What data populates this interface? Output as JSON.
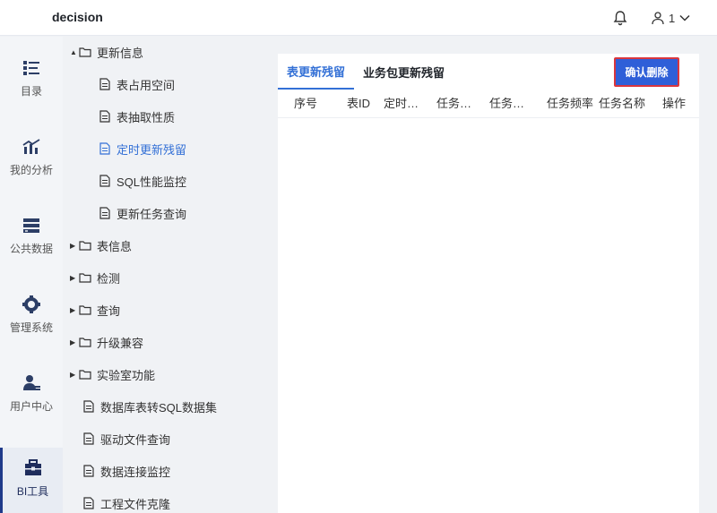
{
  "header": {
    "app_title": "decision",
    "user_label": "1"
  },
  "nav": {
    "items": [
      {
        "label": "目录",
        "icon": "list-icon"
      },
      {
        "label": "我的分析",
        "icon": "chart-icon"
      },
      {
        "label": "公共数据",
        "icon": "database-icon"
      },
      {
        "label": "管理系统",
        "icon": "gear-icon"
      },
      {
        "label": "用户中心",
        "icon": "user-icon"
      },
      {
        "label": "BI工具",
        "icon": "toolbox-icon"
      }
    ]
  },
  "tree": {
    "nodes": [
      {
        "label": "更新信息"
      },
      {
        "label": "表占用空间"
      },
      {
        "label": "表抽取性质"
      },
      {
        "label": "定时更新残留"
      },
      {
        "label": "SQL性能监控"
      },
      {
        "label": "更新任务查询"
      },
      {
        "label": "表信息"
      },
      {
        "label": "检测"
      },
      {
        "label": "查询"
      },
      {
        "label": "升级兼容"
      },
      {
        "label": "实验室功能"
      },
      {
        "label": "数据库表转SQL数据集"
      },
      {
        "label": "驱动文件查询"
      },
      {
        "label": "数据连接监控"
      },
      {
        "label": "工程文件克隆"
      }
    ]
  },
  "main": {
    "tabs": [
      {
        "label": "表更新残留"
      },
      {
        "label": "业务包更新残留"
      }
    ],
    "confirm_button": "确认删除",
    "columns": [
      "序号",
      "表ID",
      "定时任务",
      "任务开始",
      "任务结束",
      "任务频率",
      "任务名称",
      "操作"
    ]
  },
  "colors": {
    "accent": "#3370d6",
    "button": "#2f5fd8",
    "button_border": "#d9363e"
  }
}
